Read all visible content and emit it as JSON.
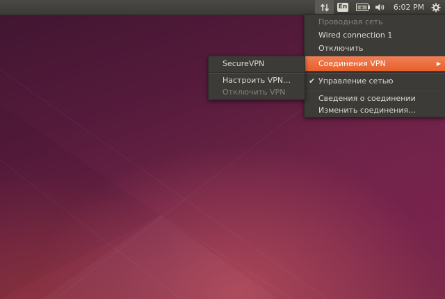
{
  "panel": {
    "clock": "6:02 PM",
    "keyboard_layout": "En",
    "icons": {
      "network": "network-updown-icon",
      "battery": "battery-icon",
      "sound": "speaker-icon",
      "settings": "gear-icon"
    }
  },
  "network_menu": {
    "items": [
      {
        "label": "Проводная сеть",
        "enabled": false
      },
      {
        "label": "Wired connection 1",
        "enabled": true
      },
      {
        "label": "Отключить",
        "enabled": true
      },
      {
        "label": "Соединения VPN",
        "enabled": true,
        "highlighted": true,
        "has_submenu": true
      },
      {
        "label": "Управление сетью",
        "enabled": true,
        "checked": true
      },
      {
        "label": "Сведения о соединении",
        "enabled": true
      },
      {
        "label": "Изменить соединения…",
        "enabled": true
      }
    ]
  },
  "vpn_submenu": {
    "items": [
      {
        "label": "SecureVPN",
        "enabled": true
      },
      {
        "label": "Настроить VPN…",
        "enabled": true
      },
      {
        "label": "Отключить VPN",
        "enabled": false
      }
    ]
  },
  "colors": {
    "panel": "#3c3b37",
    "menu_bg": "#3c3b37",
    "highlight": "#e95420",
    "text": "#dfdbd2",
    "disabled_text": "#85827a"
  }
}
